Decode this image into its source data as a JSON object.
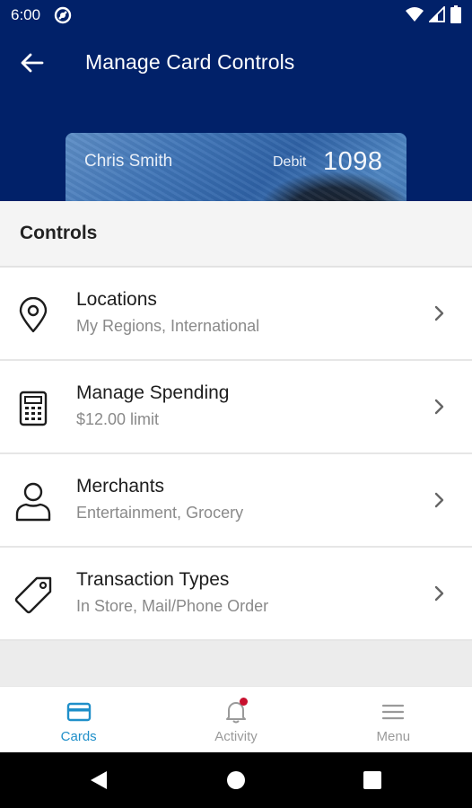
{
  "status_bar": {
    "time": "6:00"
  },
  "header": {
    "title": "Manage Card Controls"
  },
  "card": {
    "holder": "Chris Smith",
    "type": "Debit",
    "last4": "1098"
  },
  "controls": {
    "title": "Controls",
    "items": [
      {
        "title": "Locations",
        "subtitle": "My Regions, International",
        "icon": "location-pin-icon"
      },
      {
        "title": "Manage Spending",
        "subtitle": "$12.00 limit",
        "icon": "calculator-icon"
      },
      {
        "title": "Merchants",
        "subtitle": "Entertainment, Grocery",
        "icon": "person-icon"
      },
      {
        "title": "Transaction Types",
        "subtitle": "In Store, Mail/Phone Order",
        "icon": "tag-icon"
      }
    ]
  },
  "bottom_nav": {
    "items": [
      {
        "label": "Cards",
        "icon": "card-icon",
        "active": true
      },
      {
        "label": "Activity",
        "icon": "bell-icon",
        "active": false,
        "badge": true
      },
      {
        "label": "Menu",
        "icon": "hamburger-icon",
        "active": false
      }
    ]
  },
  "colors": {
    "header_bg": "#012169",
    "accent": "#1f8fc9",
    "badge": "#c8102e"
  }
}
